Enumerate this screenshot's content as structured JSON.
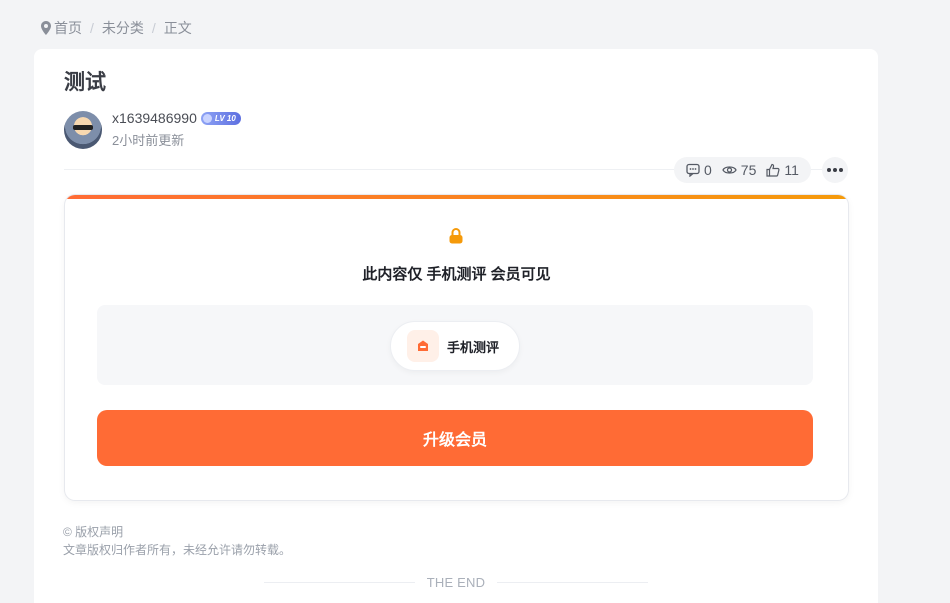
{
  "breadcrumb": {
    "items": [
      "首页",
      "未分类",
      "正文"
    ],
    "separator": "/"
  },
  "post": {
    "title": "测试",
    "author": {
      "name": "x1639486990",
      "level_badge": "LV 10",
      "updated": "2小时前更新"
    },
    "stats": {
      "comments": "0",
      "views": "75",
      "likes": "11"
    }
  },
  "vip_gate": {
    "message": "此内容仅 手机测评 会员可见",
    "level_name": "手机测评",
    "upgrade_label": "升级会员"
  },
  "footer": {
    "copyright_title": "© 版权声明",
    "copyright_text": "文章版权归作者所有，未经允许请勿转载。",
    "the_end": "THE END"
  },
  "colors": {
    "accent": "#ff6b35",
    "accent_gradient_end": "#f59a0a",
    "lock": "#f59a0a"
  },
  "icons": [
    "map-pin-icon",
    "comment-icon",
    "eye-icon",
    "thumbs-up-icon",
    "more-icon",
    "lock-icon",
    "vip-level-icon"
  ]
}
